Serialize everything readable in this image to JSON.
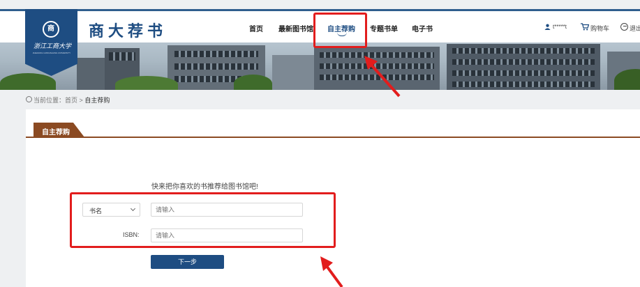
{
  "header": {
    "university_name": "浙江工商大学",
    "university_name_en": "ZHEJIANG GONGSHANG UNIVERSITY",
    "site_title": "商大荐书",
    "nav": [
      "首页",
      "最新图书馆",
      "自主荐购",
      "专题书单",
      "电子书"
    ],
    "active_nav": "自主荐购",
    "user_name": "t*****t",
    "cart_label": "购物车",
    "logout_label": "退出"
  },
  "breadcrumb": {
    "prefix": "当前位置：",
    "home": "首页",
    "sep": ">",
    "current": "自主荐购"
  },
  "tab": {
    "label": "自主荐购"
  },
  "form": {
    "intro": "快来把你喜欢的书推荐给图书馆吧!",
    "select_value": "书名",
    "title_placeholder": "请输入",
    "isbn_label": "ISBN:",
    "isbn_placeholder": "请输入",
    "next_label": "下一步"
  },
  "colors": {
    "brand_blue": "#1e4d82",
    "tab_brown": "#8b4a22",
    "highlight_red": "#e21d1d"
  }
}
